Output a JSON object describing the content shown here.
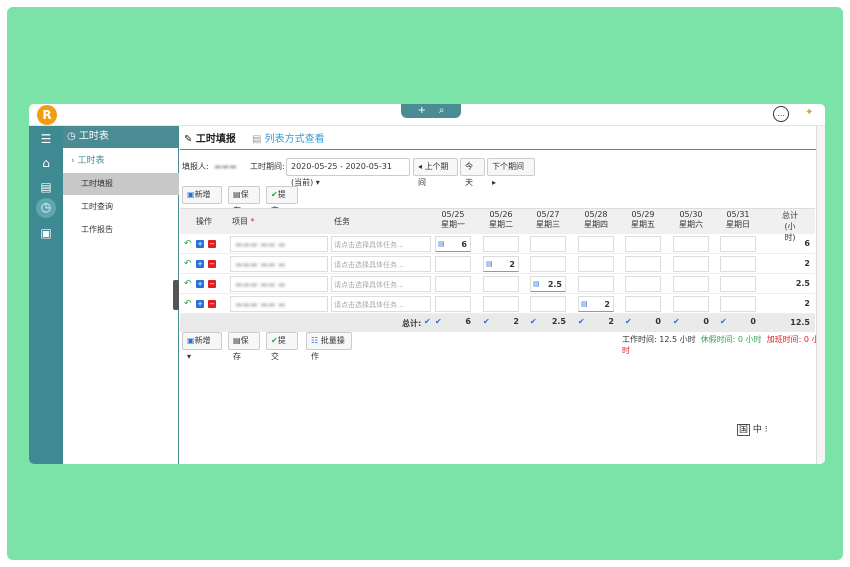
{
  "topbar": {
    "logo": "R",
    "add_icon": "+",
    "search_icon": "⌕",
    "chat_icon": "…",
    "bulb_icon": "💡"
  },
  "rail": {
    "icons": [
      "list-icon",
      "home-icon",
      "clipboard-icon",
      "clock-icon",
      "book-icon"
    ]
  },
  "sub": {
    "title": "工时表",
    "group": "工时表",
    "items": [
      "工时填报",
      "工时查询",
      "工作报告"
    ]
  },
  "tabs": {
    "active": "工时填报",
    "other": "列表方式查看"
  },
  "filter": {
    "reporter_label": "填报人:",
    "period_label": "工时期间:",
    "period_value": "2020-05-25 - 2020-05-31 (当前)",
    "prev": "上个期间",
    "today": "今天",
    "next": "下个期间"
  },
  "toolbar": {
    "new": "新增",
    "save": "保存",
    "submit": "提交",
    "batch": "批量操作"
  },
  "table": {
    "col_op": "操作",
    "col_project": "项目",
    "col_task": "任务",
    "days": [
      {
        "date": "05/25",
        "weekday": "星期一"
      },
      {
        "date": "05/26",
        "weekday": "星期二"
      },
      {
        "date": "05/27",
        "weekday": "星期三"
      },
      {
        "date": "05/28",
        "weekday": "星期四"
      },
      {
        "date": "05/29",
        "weekday": "星期五"
      },
      {
        "date": "05/30",
        "weekday": "星期六"
      },
      {
        "date": "05/31",
        "weekday": "星期日"
      }
    ],
    "col_total": "总计",
    "col_total_unit": "(小时)",
    "task_placeholder": "请点击选择具体任务...",
    "rows": [
      {
        "hours": [
          "6",
          "",
          "",
          "",
          "",
          "",
          ""
        ],
        "total": "6"
      },
      {
        "hours": [
          "",
          "2",
          "",
          "",
          "",
          "",
          ""
        ],
        "total": "2"
      },
      {
        "hours": [
          "",
          "",
          "2.5",
          "",
          "",
          "",
          ""
        ],
        "total": "2.5"
      },
      {
        "hours": [
          "",
          "",
          "",
          "2",
          "",
          "",
          ""
        ],
        "total": "2"
      }
    ],
    "total_label": "总计:",
    "day_totals": [
      "6",
      "2",
      "2.5",
      "2",
      "0",
      "0",
      "0"
    ],
    "grand_total": "12.5"
  },
  "status": {
    "work": "工作时间: 12.5 小时",
    "rest": "休假时间: 0 小时",
    "overtime": "加班时间: 0 小时"
  },
  "lang": "中",
  "colors": {
    "accent": "#4b8b94",
    "green_bg": "#7ce3a8",
    "link": "#3a9bd5",
    "rest": "#2ea44f",
    "overtime": "#e02020"
  }
}
